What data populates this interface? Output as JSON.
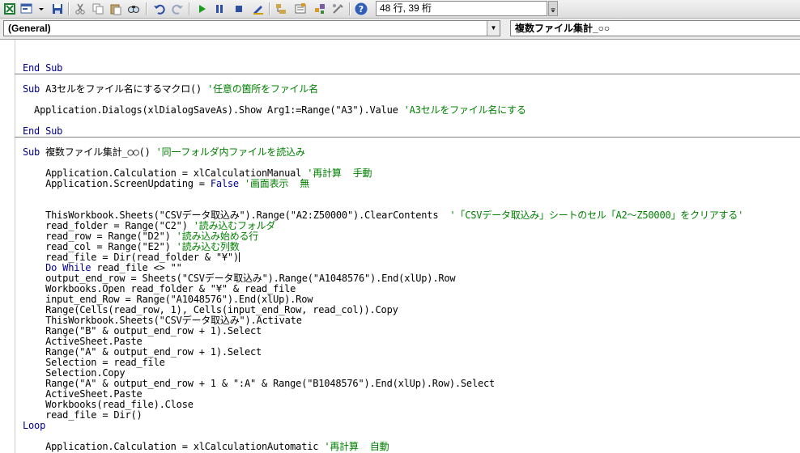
{
  "toolbar": {
    "icons": [
      "excel-view-icon",
      "insert-userform-icon",
      "save-icon",
      "cut-icon",
      "copy-icon",
      "paste-icon",
      "find-icon",
      "undo-icon",
      "redo-icon",
      "run-icon",
      "break-icon",
      "reset-icon",
      "design-mode-icon",
      "project-explorer-icon",
      "properties-window-icon",
      "object-browser-icon",
      "toolbox-icon",
      "help-icon"
    ],
    "position_text": "48 行, 39 桁"
  },
  "combos": {
    "object": "(General)",
    "procedure": "複数ファイル集計_○○"
  },
  "code": {
    "l01": "End Sub",
    "l02_kw": "Sub",
    "l02_text": " A3セルをファイル名にするマクロ() ",
    "l02_cm": "'任意の箇所をファイル名",
    "l03_text": "  Application.Dialogs(xlDialogSaveAs).Show Arg1:=Range(\"A3\").Value ",
    "l03_cm": "'A3セルをファイル名にする",
    "l04": "End Sub",
    "l05_kw": "Sub",
    "l05_text": " 複数ファイル集計_○○() ",
    "l05_cm": "'同一フォルダ内ファイルを読込み",
    "l06_text": "    Application.Calculation = xlCalculationManual ",
    "l06_cm": "'再計算  手動",
    "l07_text": "    Application.ScreenUpdating = ",
    "l07_kw": "False",
    "l07_cm": " '画面表示  無",
    "l08_text": "    ThisWorkbook.Sheets(\"CSVデータ取込み\").Range(\"A2:Z50000\").ClearContents  ",
    "l08_cm": "'「CSVデータ取込み」シートのセル「A2～Z50000」をクリアする'",
    "l09_text": "    read_folder = Range(\"C2\") ",
    "l09_cm": "'読み込むフォルダ",
    "l10_text": "    read_row = Range(\"D2\") ",
    "l10_cm": "'読み込み始める行",
    "l11_text": "    read_col = Range(\"E2\") ",
    "l11_cm": "'読み込む列数",
    "l12_text": "    read_file = Dir(read_folder & \"¥\")",
    "l13_kw": "    Do While",
    "l13_text": " read_file <> \"\"",
    "l14": "    output_end_row = Sheets(\"CSVデータ取込み\").Range(\"A1048576\").End(xlUp).Row",
    "l15": "    Workbooks.Open read_folder & \"¥\" & read_file",
    "l16": "    input_end_Row = Range(\"A1048576\").End(xlUp).Row",
    "l17": "    Range(Cells(read_row, 1), Cells(input_end_Row, read_col)).Copy",
    "l18": "    ThisWorkbook.Sheets(\"CSVデータ取込み\").Activate",
    "l19": "    Range(\"B\" & output_end_row + 1).Select",
    "l20": "    ActiveSheet.Paste",
    "l21": "    Range(\"A\" & output_end_row + 1).Select",
    "l22": "    Selection = read_file",
    "l23": "    Selection.Copy",
    "l24": "    Range(\"A\" & output_end_row + 1 & \":A\" & Range(\"B1048576\").End(xlUp).Row).Select",
    "l25": "    ActiveSheet.Paste",
    "l26": "    Workbooks(read_file).Close",
    "l27": "    read_file = Dir()",
    "l28": "Loop",
    "l29_text": "    Application.Calculation = xlCalculationAutomatic ",
    "l29_cm": "'再計算  自動"
  }
}
